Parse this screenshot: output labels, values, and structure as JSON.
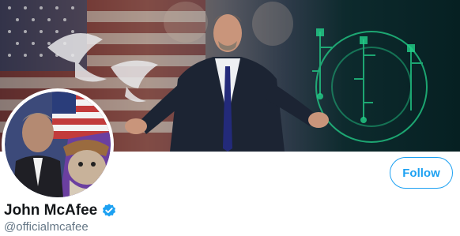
{
  "profile": {
    "display_name": "John McAfee",
    "handle": "@officialmcafee",
    "verified": true
  },
  "actions": {
    "follow_label": "Follow"
  },
  "colors": {
    "accent": "#1da1f2",
    "name_text": "#14171a",
    "handle_text": "#657786"
  },
  "icons": {
    "verified": "verified-badge-icon"
  }
}
